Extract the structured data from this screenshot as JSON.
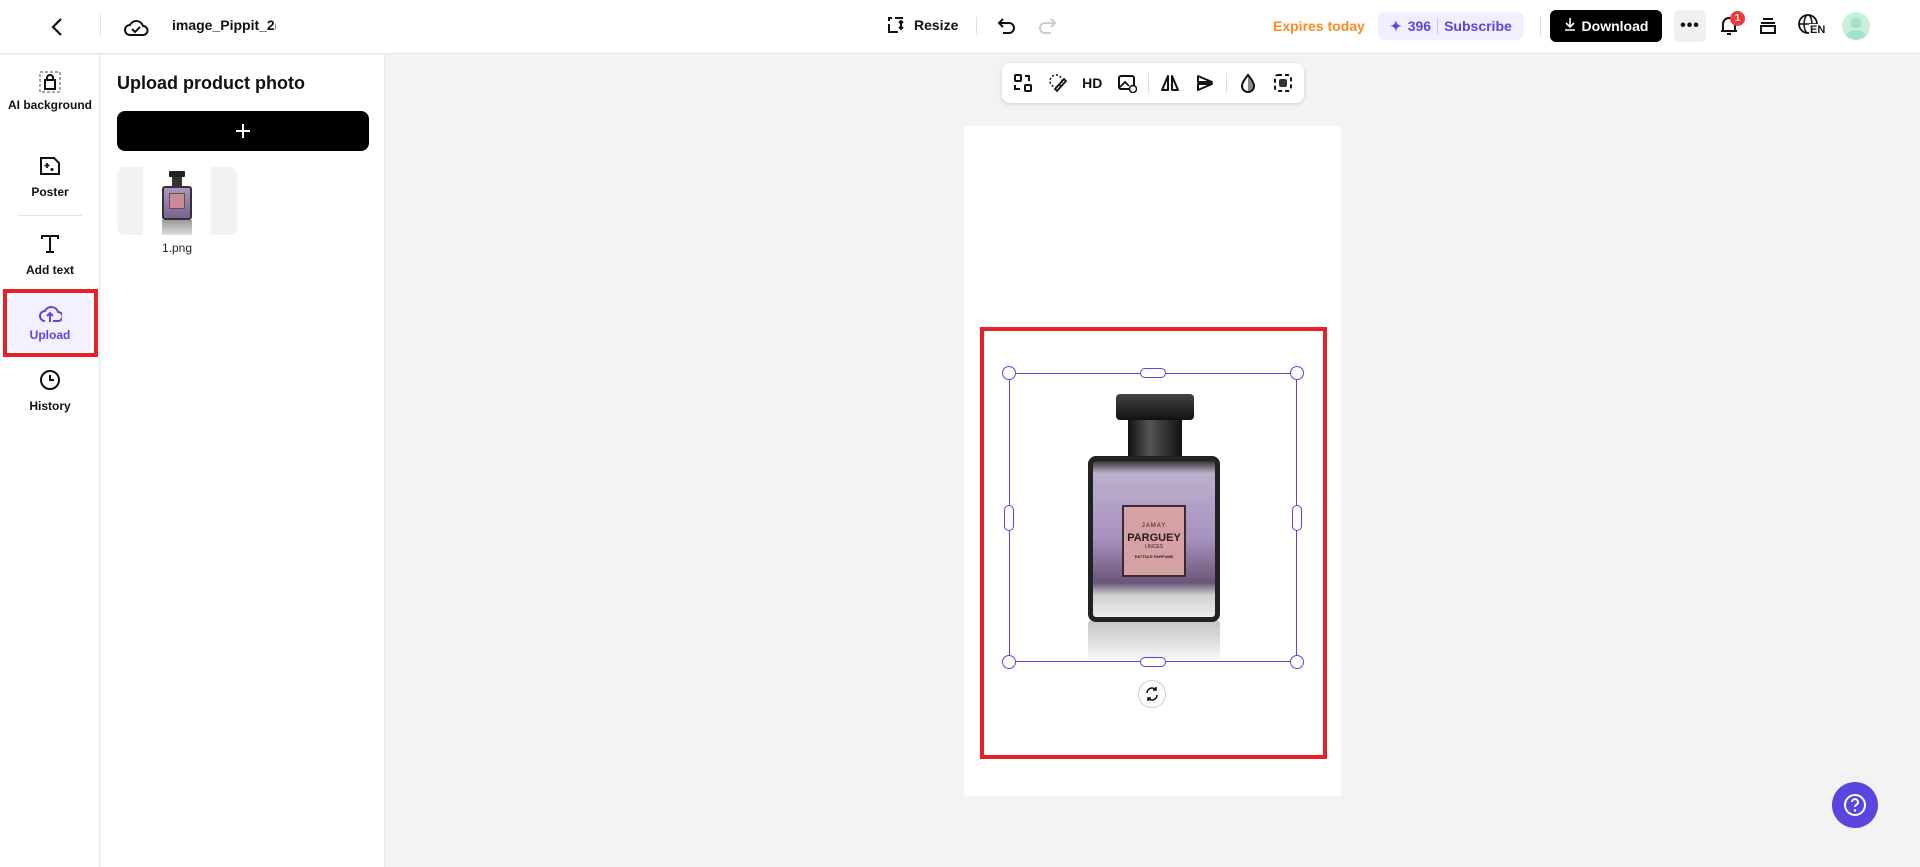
{
  "header": {
    "file_name": "image_Pippit_2(",
    "resize_label": "Resize",
    "expires": "Expires today",
    "credits": "396",
    "subscribe": "Subscribe",
    "download": "Download",
    "notification_count": "1",
    "language": "EN"
  },
  "nav": {
    "items": [
      {
        "label": "AI background"
      },
      {
        "label": "Poster"
      },
      {
        "label": "Add text"
      },
      {
        "label": "Upload",
        "active": true
      },
      {
        "label": "History"
      }
    ]
  },
  "panel": {
    "title": "Upload product photo",
    "files": [
      {
        "name": "1.png"
      }
    ]
  },
  "toolbar": {
    "hd_label": "HD"
  },
  "product": {
    "brand": "JAMAY",
    "name": "PARGUEY",
    "sub": "LINCES",
    "type": "PATTULE PARFUME"
  },
  "colors": {
    "accent": "#5b45e0",
    "highlight": "#e8202a",
    "expires": "#ff8a1f"
  }
}
